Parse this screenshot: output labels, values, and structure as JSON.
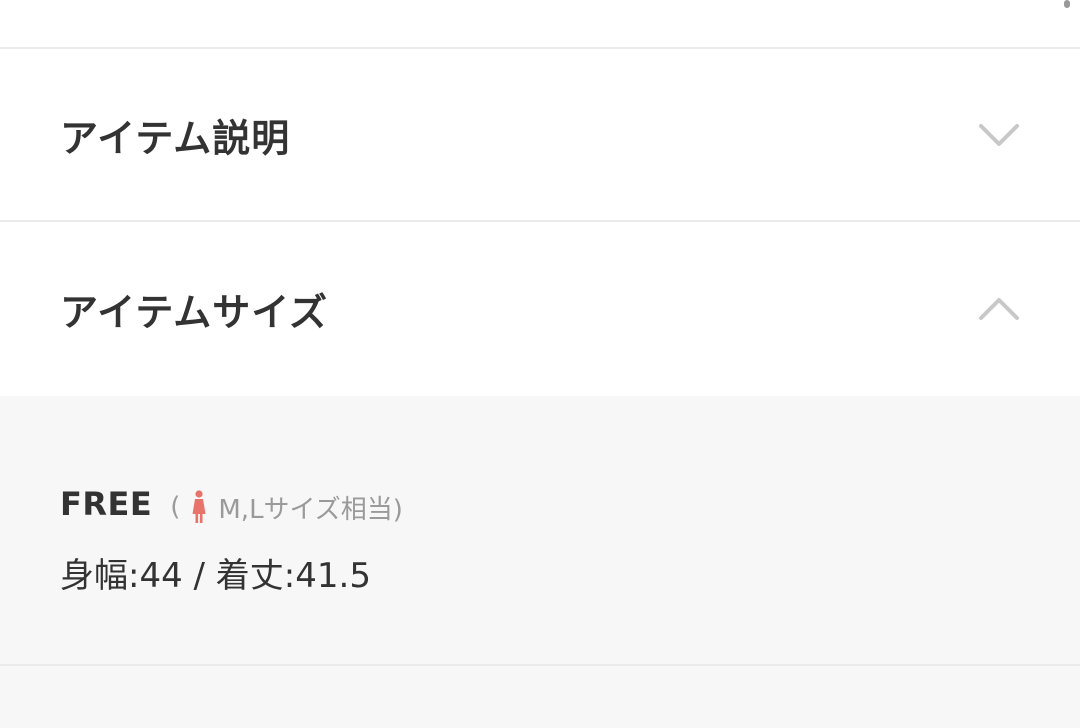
{
  "accordion": {
    "sections": [
      {
        "title": "アイテム説明",
        "expanded": false,
        "chevron": "chevron-down-icon"
      },
      {
        "title": "アイテムサイズ",
        "expanded": true,
        "chevron": "chevron-up-icon"
      }
    ]
  },
  "item_size": {
    "size_name": "FREE",
    "note_open": "(",
    "note_text": "M,Lサイズ相当)",
    "gender_icon": "female-person-icon",
    "measurement": "身幅:44 / 着丈:41.5"
  },
  "colors": {
    "accent_icon": "#e8736a",
    "muted_text": "#9a9a9a",
    "chevron": "#c8c8c8",
    "panel_bg": "#f7f7f7"
  }
}
